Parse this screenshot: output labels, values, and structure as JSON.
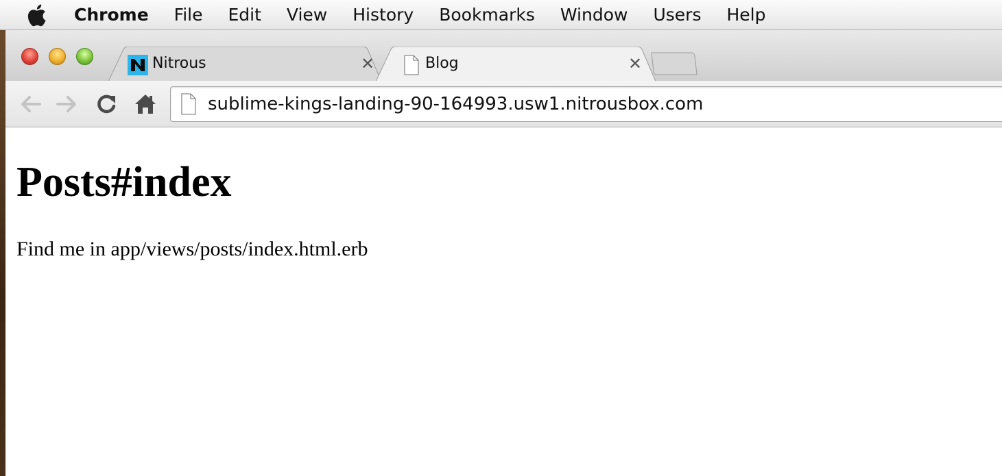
{
  "menubar": {
    "apple_icon": "apple-logo-icon",
    "app_name": "Chrome",
    "items": [
      "File",
      "Edit",
      "View",
      "History",
      "Bookmarks",
      "Window",
      "Users",
      "Help"
    ]
  },
  "browser": {
    "tabs": [
      {
        "title": "Nitrous",
        "favicon": "nitrous-n-icon",
        "active": false
      },
      {
        "title": "Blog",
        "favicon": "document-icon",
        "active": true
      }
    ],
    "toolbar": {
      "back_icon": "arrow-left-icon",
      "forward_icon": "arrow-right-icon",
      "reload_icon": "reload-icon",
      "home_icon": "home-icon"
    },
    "address_bar": {
      "url": "sublime-kings-landing-90-164993.usw1.nitrousbox.com"
    }
  },
  "page": {
    "heading": "Posts#index",
    "paragraph": "Find me in app/views/posts/index.html.erb"
  },
  "colors": {
    "nitrous_favicon": "#2bb5e8",
    "traffic_close": "#e0443b",
    "traffic_minimize": "#f0b030",
    "traffic_zoom": "#7fc43a"
  }
}
